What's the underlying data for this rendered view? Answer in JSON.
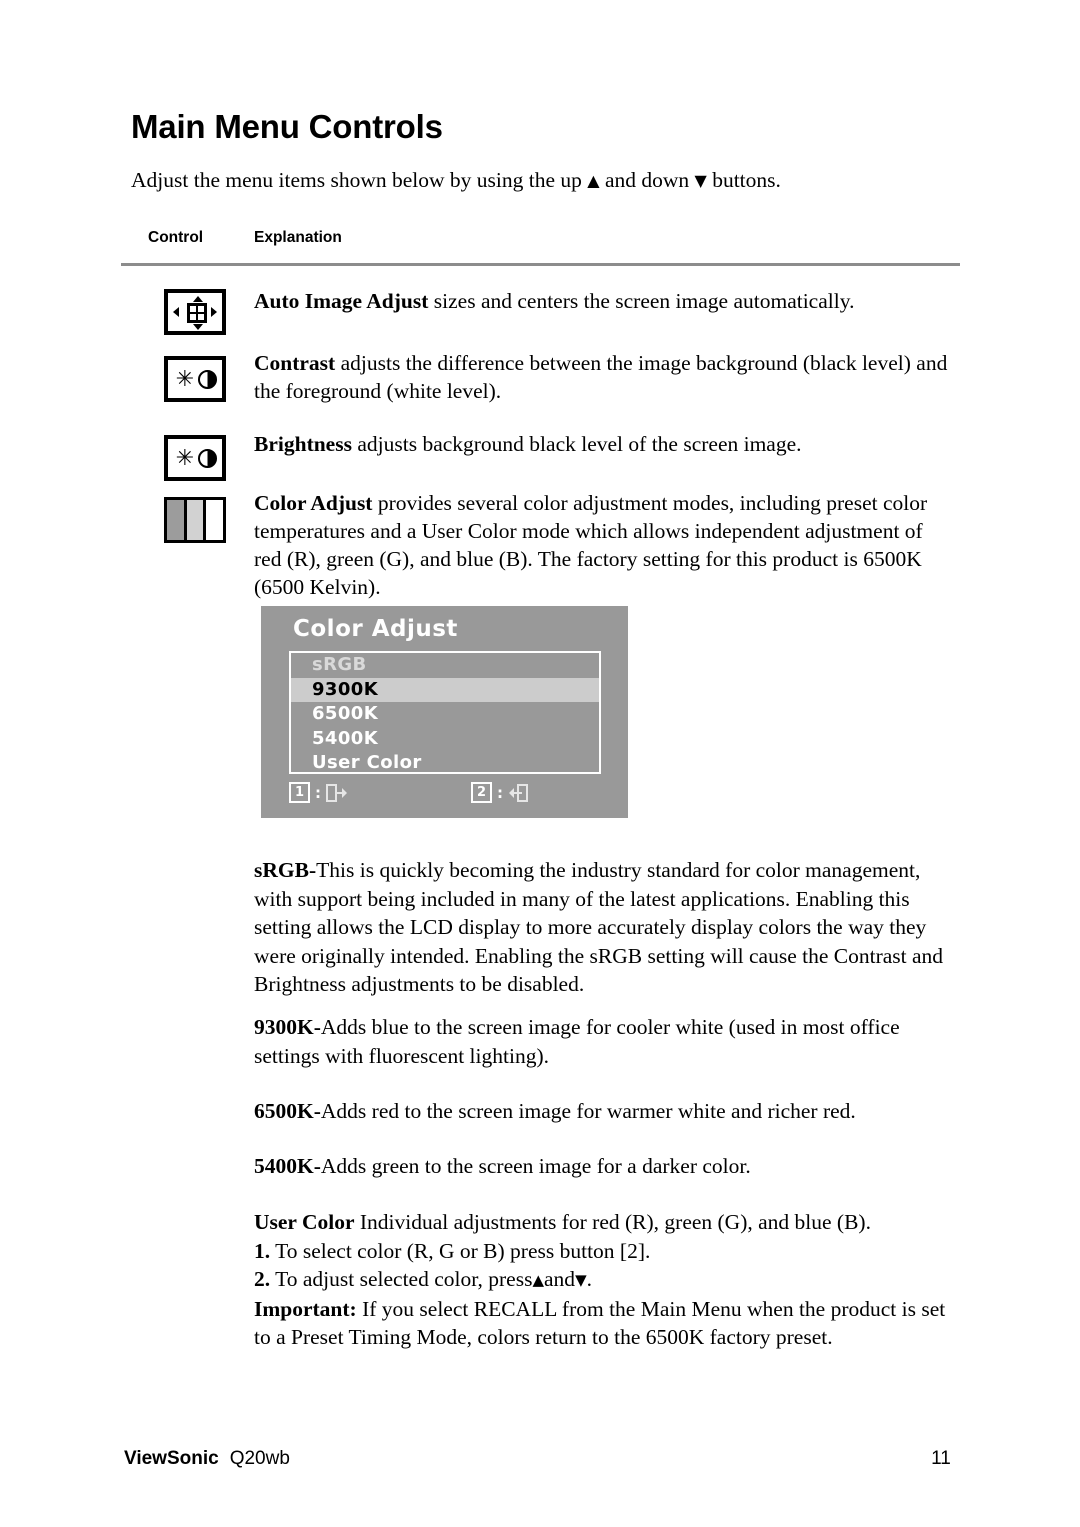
{
  "document": {
    "title": "Main Menu Controls",
    "intro_before": "Adjust the menu items shown below by using the up ",
    "intro_up_glyph": "▲",
    "intro_middle": " and down ",
    "intro_down_glyph": "▼",
    "intro_after": " buttons."
  },
  "table": {
    "header_control": "Control",
    "header_explanation": "Explanation",
    "rows": [
      {
        "icon": "auto-image-adjust-icon",
        "term": "Auto Image Adjust",
        "text": " sizes and centers the screen image automatically."
      },
      {
        "icon": "contrast-icon",
        "term": "Contrast",
        "text": " adjusts the difference between the image background  (black level) and the foreground (white level)."
      },
      {
        "icon": "brightness-icon",
        "term": "Brightness",
        "text": " adjusts background black level of the screen image."
      },
      {
        "icon": "color-adjust-icon",
        "term": "Color Adjust",
        "text": " provides several color adjustment modes, including preset color temperatures and a User Color mode which allows independent adjustment of red (R), green (G), and blue (B). The factory setting for this product is 6500K (6500 Kelvin)."
      }
    ]
  },
  "osd": {
    "title": "Color Adjust",
    "items": [
      {
        "label": "sRGB",
        "state": "dim"
      },
      {
        "label": "9300K",
        "state": "selected"
      },
      {
        "label": "6500K",
        "state": "normal"
      },
      {
        "label": "5400K",
        "state": "normal"
      },
      {
        "label": "User Color",
        "state": "normal"
      }
    ],
    "footer": {
      "key1": "1",
      "key1_colon": ":",
      "key1_icon": "exit-out-icon",
      "key2": "2",
      "key2_colon": ":",
      "key2_icon": "enter-in-icon"
    },
    "colors": {
      "background": "#999999",
      "highlight": "#cccccc",
      "text": "#ffffff",
      "selected_text": "#000000"
    }
  },
  "descriptions": {
    "srgb": {
      "term": "sRGB-",
      "text": "This is quickly becoming the industry standard for color management, with support being included in many of the latest applications. Enabling this setting allows the LCD display to more accurately display colors the way they were originally intended. Enabling the sRGB setting will cause the Contrast and Brightness adjustments to be disabled."
    },
    "k9300": {
      "term": "9300K-",
      "text": "Adds blue to the screen image for cooler white (used in most office settings with fluorescent lighting)."
    },
    "k6500": {
      "term": "6500K-",
      "text": "Adds red to the screen image for warmer white and richer red."
    },
    "k5400": {
      "term": "5400K-",
      "text": "Adds green to the screen image for a darker color."
    },
    "user_color": {
      "term": "User Color",
      "text": "  Individual adjustments for red (R), green (G),  and blue (B).",
      "step1_num": "1.",
      "step1_text": " To select color (R, G or B) press button [2].",
      "step2_num": "2.",
      "step2_text_before": " To adjust selected color, press",
      "step2_up": "▲",
      "step2_mid": "and",
      "step2_down": "▼",
      "step2_after": ".",
      "important_term": "Important:",
      "important_text": " If you select RECALL from the Main Menu when the product is set to a Preset Timing Mode, colors return to the 6500K factory preset."
    }
  },
  "footer": {
    "brand": "ViewSonic",
    "model": "Q20wb",
    "page_number": "11"
  }
}
